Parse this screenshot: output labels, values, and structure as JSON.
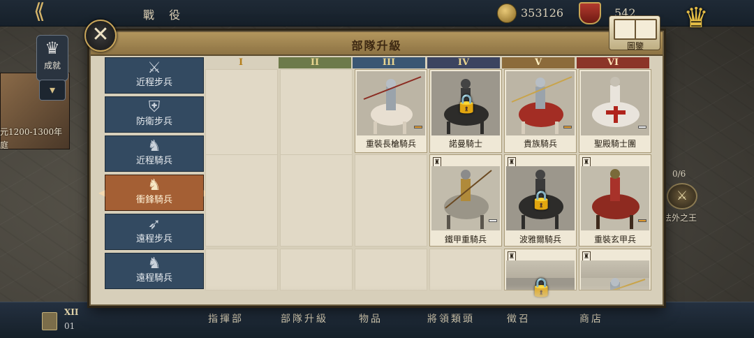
{
  "topbar": {
    "back_icon": "back-arrow-icon",
    "title": "戰 役",
    "coins": "353126",
    "crests": "542"
  },
  "left_panel": {
    "trophy_label": "成就",
    "era_label": "元1200-1300年",
    "era_sub": "庭"
  },
  "right_panel": {
    "progress": "0/6",
    "label": "法外之王"
  },
  "bottom_nav": {
    "items": [
      "指揮部",
      "部隊升級",
      "物品",
      "將領類頭",
      "徵召",
      "商店"
    ],
    "roman": "XII",
    "sub": "01"
  },
  "dialog": {
    "title": "部隊升級",
    "codex_label": "圖鑒",
    "close_icon": "close-x-icon"
  },
  "categories": [
    {
      "label": "近程步兵",
      "icon": "crossed-swords-icon"
    },
    {
      "label": "防衛步兵",
      "icon": "shield-icon"
    },
    {
      "label": "近程騎兵",
      "icon": "horse-head-icon"
    },
    {
      "label": "衝鋒騎兵",
      "icon": "lance-horse-icon",
      "active": true
    },
    {
      "label": "遠程步兵",
      "icon": "crossbow-icon"
    },
    {
      "label": "遠程騎兵",
      "icon": "mounted-archer-icon"
    }
  ],
  "tiers": [
    "I",
    "II",
    "III",
    "IV",
    "V",
    "VI"
  ],
  "units": [
    {
      "name": "重裝長槍騎兵",
      "tier": "III",
      "locked": false
    },
    {
      "name": "諾曼騎士",
      "tier": "IV",
      "locked": true
    },
    {
      "name": "貴族騎兵",
      "tier": "V",
      "locked": false
    },
    {
      "name": "聖殿騎士團",
      "tier": "VI",
      "locked": false
    },
    {
      "name": "鐵甲重騎兵",
      "tier": "IV",
      "locked": false
    },
    {
      "name": "波雅爾騎兵",
      "tier": "V",
      "locked": true
    },
    {
      "name": "重裝玄甲兵",
      "tier": "VI",
      "locked": false
    },
    {
      "name": "",
      "tier": "V",
      "locked": true
    },
    {
      "name": "",
      "tier": "VI",
      "locked": false
    }
  ],
  "colors": {
    "accent_gold": "#caa65a",
    "active_category": "#a45f34",
    "category": "#334a61"
  }
}
